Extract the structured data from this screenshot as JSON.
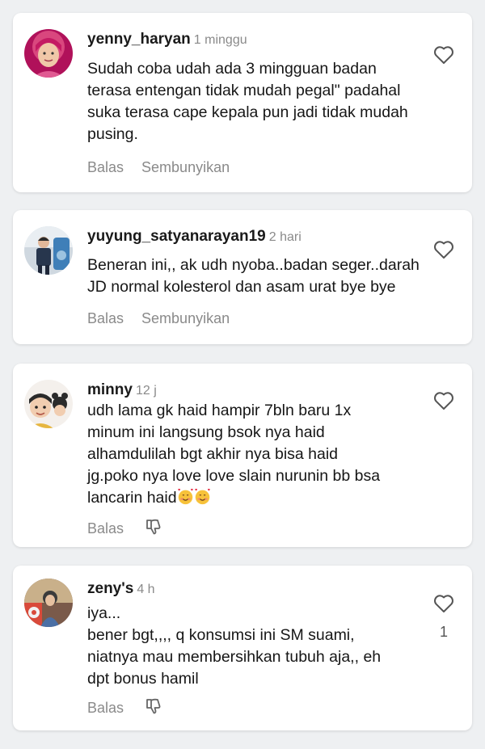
{
  "comments": [
    {
      "username": "yenny_haryan",
      "time": "1 minggu",
      "avatar_icon": "user-avatar",
      "text_lines": [
        "Sudah coba udah ada 3 mingguan badan",
        "terasa entengan  tidak mudah pegal\" padahal",
        "suka terasa cape kepala pun jadi tidak mudah",
        "pusing."
      ],
      "reply_label": "Balas",
      "hide_label": "Sembunyikan",
      "like_icon": "heart-icon"
    },
    {
      "username": "yuyung_satyanarayan19",
      "time": "2 hari",
      "avatar_icon": "user-avatar",
      "text_lines": [
        "Beneran ini,, ak udh nyoba..badan seger..darah",
        "JD normal kolesterol dan asam urat bye bye"
      ],
      "reply_label": "Balas",
      "hide_label": "Sembunyikan",
      "like_icon": "heart-icon"
    },
    {
      "username": "minny",
      "time": "12 j",
      "avatar_icon": "user-avatar",
      "text_lines": [
        "udh lama gk haid hampir 7bln baru 1x",
        "minum ini langsung bsok nya haid",
        "alhamdulilah bgt akhir nya bisa haid",
        "jg.poko nya love love slain nurunin bb bsa",
        "lancarin haid"
      ],
      "emoji_icon": "smiling-face-with-hearts-emoji",
      "reply_label": "Balas",
      "dislike_icon": "thumbs-down-icon",
      "like_icon": "heart-icon"
    },
    {
      "username": "zeny's",
      "time": "4 h",
      "avatar_icon": "user-avatar",
      "text_lines": [
        "iya...",
        "bener bgt,,,, q konsumsi ini SM suami,",
        "niatnya mau membersihkan tubuh aja,, eh",
        "dpt bonus hamil"
      ],
      "reply_label": "Balas",
      "dislike_icon": "thumbs-down-icon",
      "like_icon": "heart-icon",
      "like_count": "1"
    }
  ],
  "colors": {
    "background": "#eef0f2",
    "card": "#ffffff",
    "username": "#1a1a1a",
    "meta_text": "#8a8a8a",
    "body_text": "#161616"
  }
}
